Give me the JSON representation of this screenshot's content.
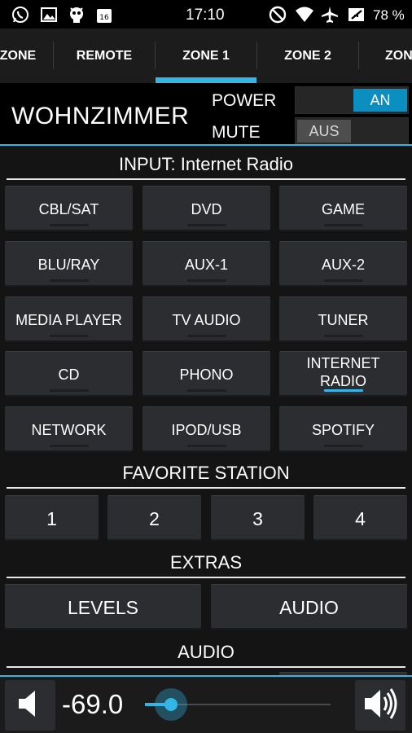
{
  "status_bar": {
    "time": "17:10",
    "battery": "78 %",
    "left_icons": [
      "whatsapp-icon",
      "image-icon",
      "robot-icon",
      "calendar-badge-icon"
    ],
    "right_icons": [
      "do-not-disturb-icon",
      "wifi-icon",
      "airplane-icon",
      "no-sim-icon",
      "battery-icon"
    ]
  },
  "tabs": [
    {
      "label": "ZONE"
    },
    {
      "label": "REMOTE"
    },
    {
      "label": "ZONE 1"
    },
    {
      "label": "ZONE 2"
    },
    {
      "label": "ZON"
    }
  ],
  "active_tab": "ZONE 1",
  "header": {
    "zone_name": "WOHNZIMMER",
    "power_label": "POWER",
    "power_state": "AN",
    "mute_label": "MUTE",
    "mute_state": "AUS"
  },
  "input": {
    "title": "INPUT: Internet Radio",
    "buttons": [
      {
        "label": "CBL/SAT"
      },
      {
        "label": "DVD"
      },
      {
        "label": "GAME"
      },
      {
        "label": "BLU/RAY"
      },
      {
        "label": "AUX-1"
      },
      {
        "label": "AUX-2"
      },
      {
        "label": "MEDIA PLAYER"
      },
      {
        "label": "TV AUDIO"
      },
      {
        "label": "TUNER"
      },
      {
        "label": "CD"
      },
      {
        "label": "PHONO"
      },
      {
        "label": "INTERNET RADIO",
        "line1": "INTERNET",
        "line2": "RADIO",
        "active": true
      },
      {
        "label": "NETWORK"
      },
      {
        "label": "IPOD/USB"
      },
      {
        "label": "SPOTIFY"
      }
    ]
  },
  "favorites": {
    "title": "FAVORITE STATION",
    "buttons": [
      {
        "label": "1"
      },
      {
        "label": "2"
      },
      {
        "label": "3"
      },
      {
        "label": "4"
      }
    ]
  },
  "extras": {
    "title": "EXTRAS",
    "buttons": [
      {
        "label": "LEVELS"
      },
      {
        "label": "AUDIO"
      }
    ]
  },
  "audio": {
    "title": "AUDIO"
  },
  "volume": {
    "value": "-69.0",
    "slider_fraction": 0.14,
    "icons": [
      "volume-down-icon",
      "volume-up-icon"
    ]
  },
  "colors": {
    "accent": "#33b5e5",
    "toggle_on": "#0a8fc0",
    "button": "#2b2d30"
  }
}
